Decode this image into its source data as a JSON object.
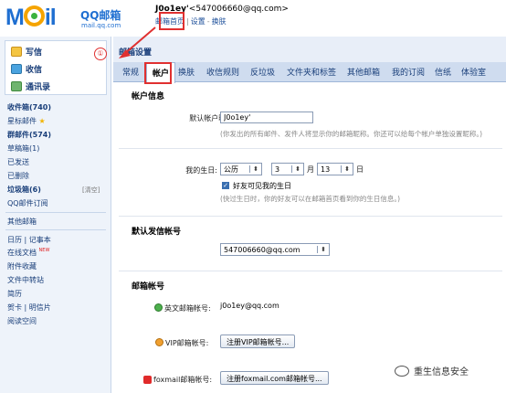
{
  "logo": {
    "mail": "Mail",
    "qq": "QQ邮箱",
    "url": "mail.qq.com"
  },
  "user": {
    "name": "J0o1ey'",
    "email": "<547006660@qq.com>",
    "links": [
      "邮箱首页",
      "设置",
      "换肤"
    ]
  },
  "sidebar": {
    "buttons": [
      {
        "label": "写信",
        "icon": "pencil-icon"
      },
      {
        "label": "收信",
        "icon": "inbox-icon"
      },
      {
        "label": "通讯录",
        "icon": "contacts-icon"
      }
    ],
    "annotation_number": "①",
    "folders": [
      {
        "label": "收件箱(740)",
        "bold": true
      },
      {
        "label": "星标邮件",
        "star": "★"
      },
      {
        "label": "群邮件(574)",
        "bold": true
      },
      {
        "label": "草稿箱(1)"
      },
      {
        "label": "已发送"
      },
      {
        "label": "已删除"
      },
      {
        "label": "垃圾箱(6)",
        "bold": true,
        "clear": "[清空]"
      },
      {
        "label": "QQ邮件订阅"
      }
    ],
    "folders2": [
      {
        "label": "其他邮箱"
      }
    ],
    "tools": [
      {
        "label": "日历 | 记事本"
      },
      {
        "label": "在线文档",
        "badge": "NEW"
      },
      {
        "label": "附件收藏"
      },
      {
        "label": "文件中转站"
      },
      {
        "label": "简历"
      },
      {
        "label": "贺卡 | 明信片"
      },
      {
        "label": "阅读空间"
      }
    ]
  },
  "main": {
    "title": "邮箱设置",
    "tabs": [
      "常规",
      "帐户",
      "换肤",
      "收信规则",
      "反垃圾",
      "文件夹和标签",
      "其他邮箱",
      "我的订阅",
      "信纸",
      "体验室"
    ],
    "active_tab": "帐户",
    "account_info": {
      "heading": "帐户信息",
      "nickname_label": "默认帐户昵称:",
      "nickname_value": "J0o1ey'",
      "nickname_hint": "(你发出的所有邮件、发件人将显示你的邮箱昵称。你还可以给每个帐户单独设置昵称。)",
      "birthday_label": "我的生日:",
      "calendar": "公历",
      "month": "3",
      "month_unit": "月",
      "day": "13",
      "day_unit": "日",
      "friends_checkbox": "好友可见我的生日",
      "birthday_hint": "(快过生日时，你的好友可以在邮箱首页看到你的生日信息。)"
    },
    "default_sender": {
      "heading": "默认发信帐号",
      "value": "547006660@qq.com"
    },
    "mail_accounts": {
      "heading": "邮箱帐号",
      "english_label": "英文邮箱帐号:",
      "english_value": "j0o1ey@qq.com",
      "vip_label": "VIP邮箱帐号:",
      "vip_button": "注册VIP邮箱帐号...",
      "foxmail_label": "foxmail邮箱帐号:",
      "foxmail_button": "注册foxmail.com邮箱帐号..."
    }
  },
  "watermark": "重生信息安全",
  "colors": {
    "brand": "#1f6fd1",
    "annotation_red": "#e03030",
    "tab_bar": "#cfdcef"
  }
}
